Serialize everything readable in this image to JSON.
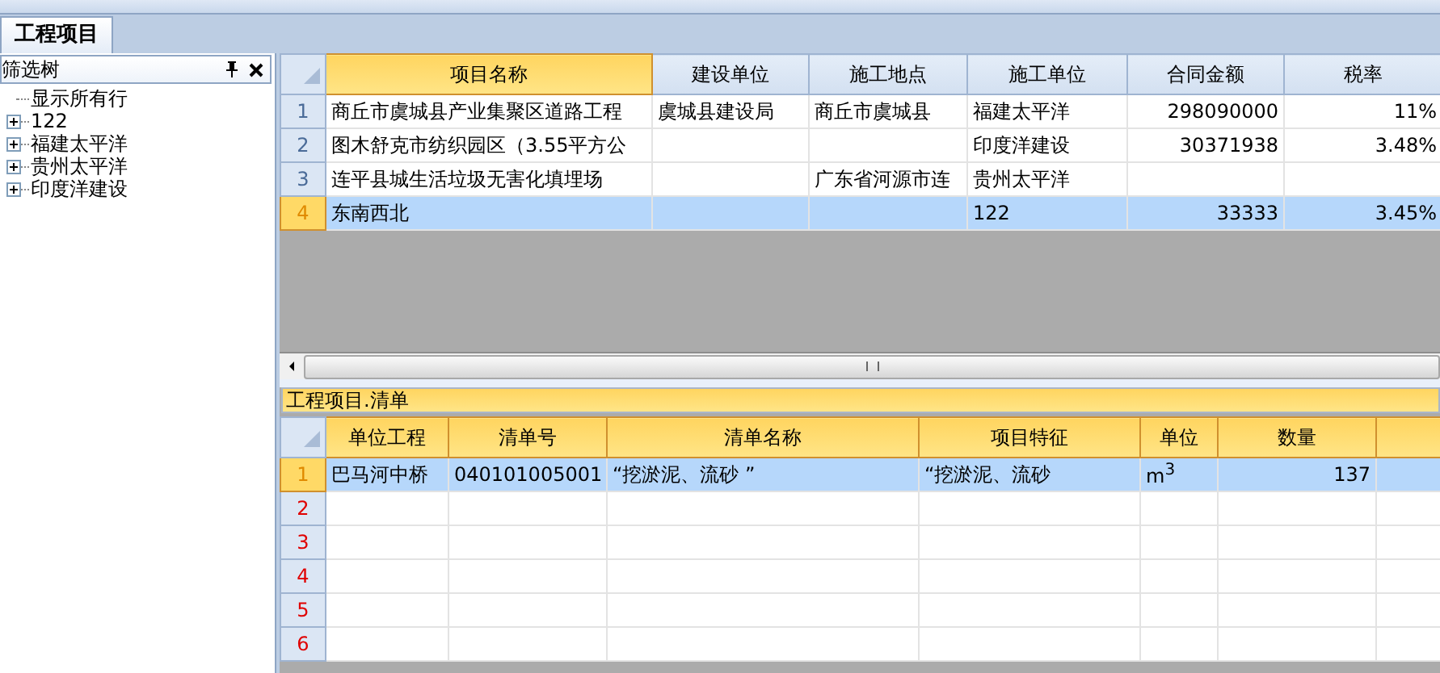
{
  "tabs": [
    {
      "label": "工程项目",
      "selected": true
    }
  ],
  "filter_panel": {
    "title": "筛选树",
    "items": [
      {
        "label": "显示所有行",
        "kind": "leaf"
      },
      {
        "label": "122",
        "kind": "collapsed"
      },
      {
        "label": "福建太平洋",
        "kind": "collapsed"
      },
      {
        "label": "贵州太平洋",
        "kind": "collapsed"
      },
      {
        "label": "印度洋建设",
        "kind": "collapsed"
      }
    ]
  },
  "projects_table": {
    "columns": [
      {
        "label": "项目名称",
        "selected": true
      },
      {
        "label": "建设单位",
        "selected": false
      },
      {
        "label": "施工地点",
        "selected": false
      },
      {
        "label": "施工单位",
        "selected": false
      },
      {
        "label": "合同金额",
        "selected": false
      },
      {
        "label": "税率",
        "selected": false
      }
    ],
    "rows": [
      {
        "number": "1",
        "selected": false,
        "cells": [
          "商丘市虞城县产业集聚区道路工程",
          "虞城县建设局",
          "商丘市虞城县",
          "福建太平洋",
          "298090000",
          "11%"
        ]
      },
      {
        "number": "2",
        "selected": false,
        "cells": [
          "图木舒克市纺织园区（3.55平方公",
          "",
          "",
          "印度洋建设",
          "30371938",
          "3.48%"
        ]
      },
      {
        "number": "3",
        "selected": false,
        "cells": [
          "连平县城生活垃圾无害化填埋场",
          "",
          "广东省河源市连",
          "贵州太平洋",
          "",
          ""
        ]
      },
      {
        "number": "4",
        "selected": true,
        "cells": [
          "东南西北",
          "",
          "",
          "122",
          "33333",
          "3.45%"
        ]
      }
    ]
  },
  "detail_panel": {
    "title": "工程项目.清单"
  },
  "items_table": {
    "columns": [
      {
        "label": "单位工程",
        "selected": true
      },
      {
        "label": "清单号",
        "selected": true
      },
      {
        "label": "清单名称",
        "selected": true
      },
      {
        "label": "项目特征",
        "selected": true
      },
      {
        "label": "单位",
        "selected": true
      },
      {
        "label": "数量",
        "selected": true
      },
      {
        "selected": true
      }
    ],
    "rows": [
      {
        "number": "1",
        "selected": true,
        "cells": [
          "巴马河中桥",
          "040101005001",
          "“挖淤泥、流砂 ”",
          "“挖淤泥、流砂",
          "m$^{3}$",
          "137",
          ""
        ]
      },
      {
        "number": "2",
        "selected": false,
        "cells": [
          "",
          "",
          "",
          "",
          "",
          "",
          ""
        ]
      },
      {
        "number": "3",
        "selected": false,
        "cells": [
          "",
          "",
          "",
          "",
          "",
          "",
          ""
        ]
      },
      {
        "number": "4",
        "selected": false,
        "cells": [
          "",
          "",
          "",
          "",
          "",
          "",
          ""
        ]
      },
      {
        "number": "5",
        "selected": false,
        "cells": [
          "",
          "",
          "",
          "",
          "",
          "",
          ""
        ]
      },
      {
        "number": "6",
        "selected": false,
        "cells": [
          "",
          "",
          "",
          "",
          "",
          "",
          ""
        ]
      }
    ]
  }
}
